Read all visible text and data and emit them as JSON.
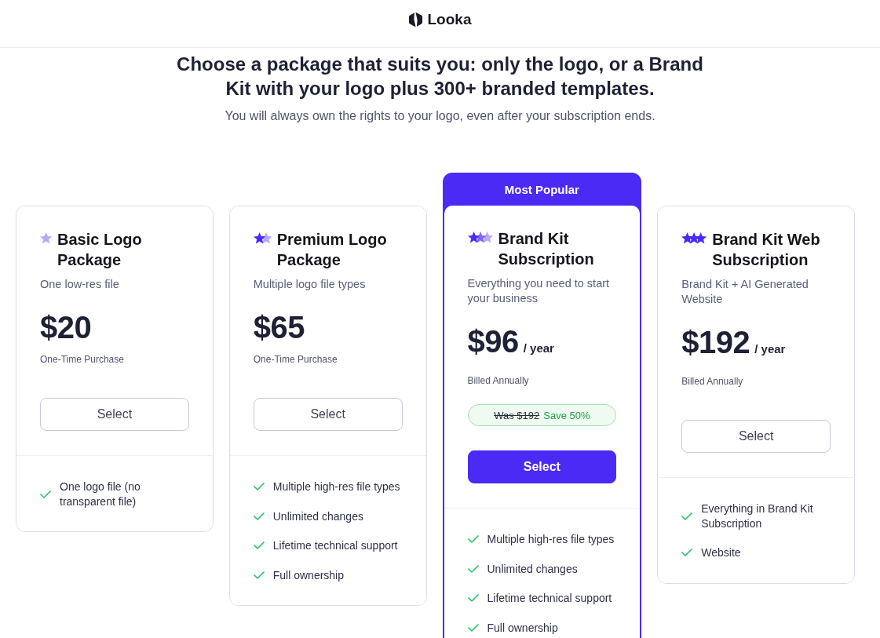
{
  "header": {
    "logo_text": "Looka"
  },
  "intro": {
    "headline": "Choose a package that suits you: only the logo, or a Brand Kit with your logo plus 300+ branded templates.",
    "subtitle": "You will always own the rights to your logo, even after your subscription ends."
  },
  "plans": [
    {
      "name": "Basic Logo Package",
      "featured": false,
      "description": "One low-res file",
      "price": "$20",
      "billing": "One-Time Purchase",
      "button": "Select",
      "features": [
        "One logo file (no transparent file)"
      ]
    },
    {
      "name": "Premium Logo Package",
      "featured": false,
      "description": "Multiple logo file types",
      "price": "$65",
      "billing": "One-Time Purchase",
      "button": "Select",
      "features": [
        "Multiple high-res file types",
        "Unlimited changes",
        "Lifetime technical support",
        "Full ownership"
      ]
    },
    {
      "name": "Brand Kit Subscription",
      "featured": true,
      "badge": "Most Popular",
      "description": "Everything you need to start your business",
      "price": "$96",
      "period": "/ year",
      "billing": "Billed Annually",
      "discount": {
        "was": "Was $192",
        "save": "Save 50%"
      },
      "button": "Select",
      "features": [
        "Multiple high-res file types",
        "Unlimited changes",
        "Lifetime technical support",
        "Full ownership"
      ]
    },
    {
      "name": "Brand Kit Web Subscription",
      "featured": false,
      "description": "Brand Kit + AI Generated Website",
      "price": "$192",
      "period": "/ year",
      "billing": "Billed Annually",
      "button": "Select",
      "features": [
        "Everything in Brand Kit Subscription",
        "Website"
      ]
    }
  ]
}
